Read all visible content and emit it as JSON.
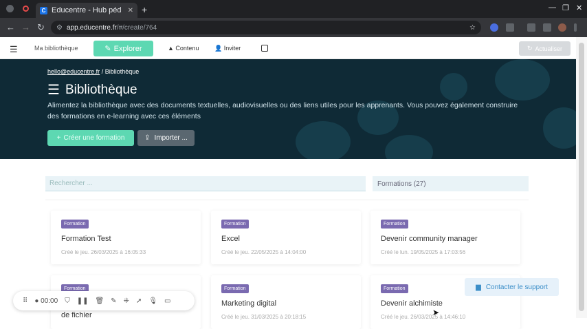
{
  "browser": {
    "tab_title": "Educentre - Hub péd",
    "url_host": "app.educentre.fr",
    "url_path": "/#/create/764"
  },
  "header": {
    "library": "Ma bibliothèque",
    "explore": "Explorer",
    "content": "Contenu",
    "invite": "Inviter",
    "update": "Actualiser"
  },
  "hero": {
    "breadcrumb_user": "hello@educentre.fr",
    "breadcrumb_sep": "/",
    "breadcrumb_current": "Bibliothèque",
    "title": "Bibliothèque",
    "description": "Alimentez la bibliothèque avec des documents textuelles, audiovisuelles ou des liens utiles pour les apprenants. Vous pouvez également construire des formations en e-learning avec ces éléments",
    "create_btn": "Créer une formation",
    "import_btn": "Importer ..."
  },
  "filters": {
    "search_placeholder": "Rechercher ...",
    "type_filter": "Formations (27)"
  },
  "cards": [
    {
      "badge": "Formation",
      "title": "Formation Test",
      "date": "Créé le jeu. 26/03/2025 à 16:05:33"
    },
    {
      "badge": "Formation",
      "title": "Excel",
      "date": "Créé le jeu. 22/05/2025 à 14:04:00"
    },
    {
      "badge": "Formation",
      "title": "Devenir community manager",
      "date": "Créé le lun. 19/05/2025 à 17:03:56"
    },
    {
      "badge": "Formation",
      "title": "de fichier",
      "date": ""
    },
    {
      "badge": "Formation",
      "title": "Marketing digital",
      "date": "Créé le jeu. 31/03/2025 à 20:18:15"
    },
    {
      "badge": "Formation",
      "title": "Devenir alchimiste",
      "date": "Créé le jeu. 26/03/2025 à 14:46:10"
    }
  ],
  "support": "Contacter le support",
  "recorder": {
    "time": "00:00"
  }
}
